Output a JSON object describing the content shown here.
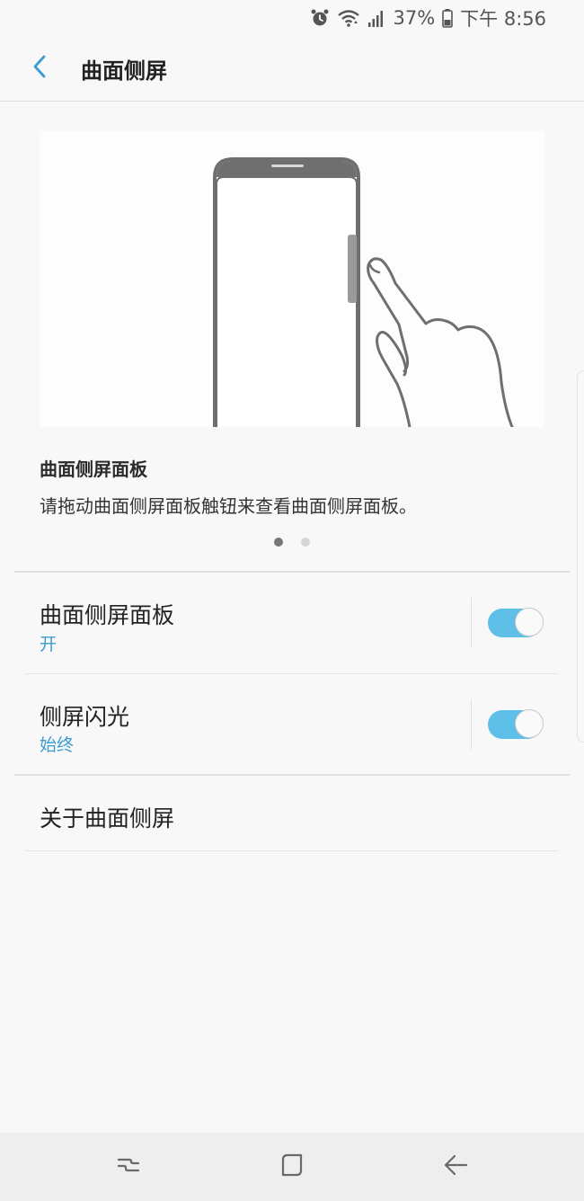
{
  "status_bar": {
    "battery": "37%",
    "time": "下午 8:56",
    "icons": [
      "alarm-icon",
      "wifi-icon",
      "signal-icon",
      "battery-icon"
    ]
  },
  "header": {
    "back_icon": "chevron-left-icon",
    "title": "曲面侧屏"
  },
  "intro_card": {
    "title": "曲面侧屏面板",
    "description": "请拖动曲面侧屏面板触钮来查看曲面侧屏面板。",
    "page_count": 2,
    "active_page": 1
  },
  "settings": {
    "panels": {
      "title": "曲面侧屏面板",
      "status": "开",
      "enabled": true
    },
    "edge_lighting": {
      "title": "侧屏闪光",
      "status": "始终",
      "enabled": true
    },
    "about": {
      "title": "关于曲面侧屏"
    }
  },
  "nav_bar": {
    "icons": [
      "recents-icon",
      "home-icon",
      "back-icon"
    ]
  },
  "colors": {
    "accent": "#3d9bd0",
    "switch_on": "#5ec0e8",
    "background": "#f8f8f8",
    "nav_bar": "#eeeeee"
  }
}
